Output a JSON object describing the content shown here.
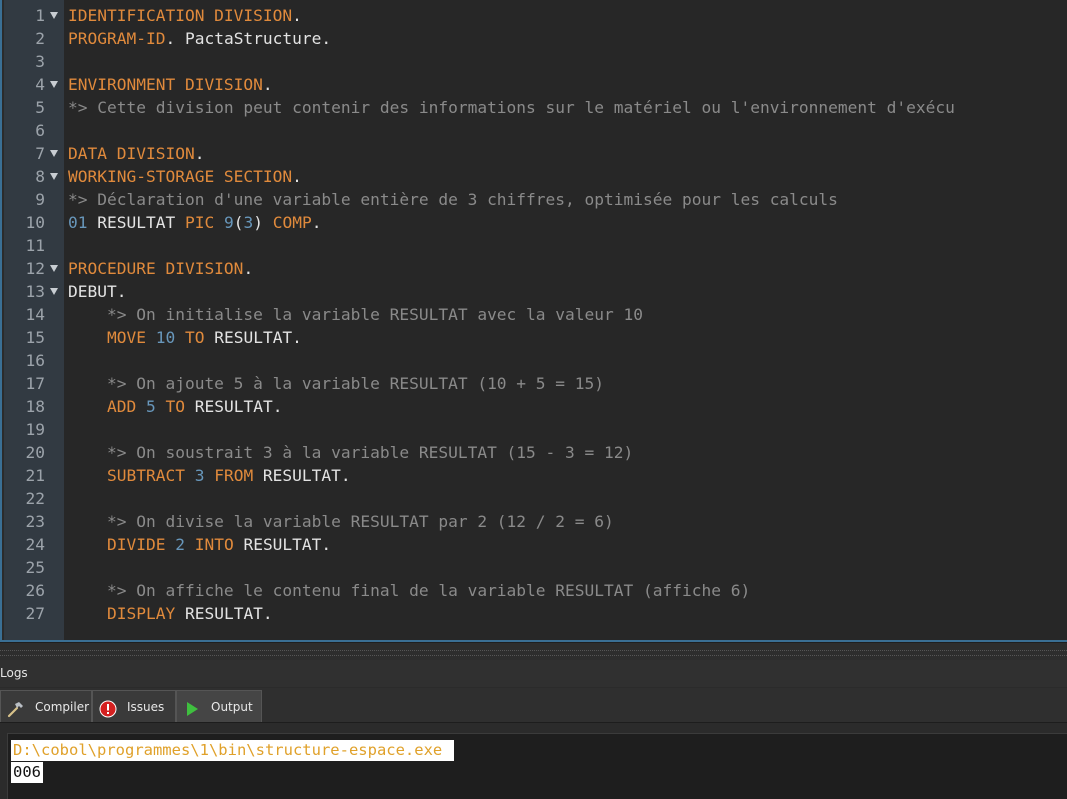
{
  "editor": {
    "lines": [
      {
        "n": "1",
        "fold": true,
        "segs": [
          {
            "t": "IDENTIFICATION DIVISION",
            "c": "kw"
          },
          {
            "t": ".",
            "c": "plain"
          }
        ]
      },
      {
        "n": "2",
        "fold": false,
        "segs": [
          {
            "t": "PROGRAM-ID",
            "c": "kw"
          },
          {
            "t": ". PactaStructure.",
            "c": "plain"
          }
        ]
      },
      {
        "n": "3",
        "fold": false,
        "segs": []
      },
      {
        "n": "4",
        "fold": true,
        "segs": [
          {
            "t": "ENVIRONMENT DIVISION",
            "c": "kw"
          },
          {
            "t": ".",
            "c": "plain"
          }
        ]
      },
      {
        "n": "5",
        "fold": false,
        "segs": [
          {
            "t": "*> Cette division peut contenir des informations sur le matériel ou l'environnement d'exécu",
            "c": "cmt"
          }
        ]
      },
      {
        "n": "6",
        "fold": false,
        "segs": []
      },
      {
        "n": "7",
        "fold": true,
        "segs": [
          {
            "t": "DATA DIVISION",
            "c": "kw"
          },
          {
            "t": ".",
            "c": "plain"
          }
        ]
      },
      {
        "n": "8",
        "fold": true,
        "segs": [
          {
            "t": "WORKING-STORAGE SECTION",
            "c": "kw"
          },
          {
            "t": ".",
            "c": "plain"
          }
        ]
      },
      {
        "n": "9",
        "fold": false,
        "segs": [
          {
            "t": "*> Déclaration d'une variable entière de 3 chiffres, optimisée pour les calculs",
            "c": "cmt"
          }
        ]
      },
      {
        "n": "10",
        "fold": false,
        "segs": [
          {
            "t": "01",
            "c": "num"
          },
          {
            "t": " RESULTAT ",
            "c": "plain"
          },
          {
            "t": "PIC",
            "c": "kw"
          },
          {
            "t": " ",
            "c": "plain"
          },
          {
            "t": "9",
            "c": "num"
          },
          {
            "t": "(",
            "c": "plain"
          },
          {
            "t": "3",
            "c": "num"
          },
          {
            "t": ") ",
            "c": "plain"
          },
          {
            "t": "COMP",
            "c": "kw"
          },
          {
            "t": ".",
            "c": "plain"
          }
        ]
      },
      {
        "n": "11",
        "fold": false,
        "segs": []
      },
      {
        "n": "12",
        "fold": true,
        "segs": [
          {
            "t": "PROCEDURE DIVISION",
            "c": "kw"
          },
          {
            "t": ".",
            "c": "plain"
          }
        ]
      },
      {
        "n": "13",
        "fold": true,
        "segs": [
          {
            "t": "DEBUT.",
            "c": "plain"
          }
        ]
      },
      {
        "n": "14",
        "fold": false,
        "segs": [
          {
            "t": "    *> On initialise la variable RESULTAT avec la valeur 10",
            "c": "cmt"
          }
        ]
      },
      {
        "n": "15",
        "fold": false,
        "segs": [
          {
            "t": "    ",
            "c": "plain"
          },
          {
            "t": "MOVE",
            "c": "kw"
          },
          {
            "t": " ",
            "c": "plain"
          },
          {
            "t": "10",
            "c": "num"
          },
          {
            "t": " ",
            "c": "plain"
          },
          {
            "t": "TO",
            "c": "kw"
          },
          {
            "t": " RESULTAT.",
            "c": "plain"
          }
        ]
      },
      {
        "n": "16",
        "fold": false,
        "segs": []
      },
      {
        "n": "17",
        "fold": false,
        "segs": [
          {
            "t": "    *> On ajoute 5 à la variable RESULTAT (10 + 5 = 15)",
            "c": "cmt"
          }
        ]
      },
      {
        "n": "18",
        "fold": false,
        "segs": [
          {
            "t": "    ",
            "c": "plain"
          },
          {
            "t": "ADD",
            "c": "kw"
          },
          {
            "t": " ",
            "c": "plain"
          },
          {
            "t": "5",
            "c": "num"
          },
          {
            "t": " ",
            "c": "plain"
          },
          {
            "t": "TO",
            "c": "kw"
          },
          {
            "t": " RESULTAT.",
            "c": "plain"
          }
        ]
      },
      {
        "n": "19",
        "fold": false,
        "segs": []
      },
      {
        "n": "20",
        "fold": false,
        "segs": [
          {
            "t": "    *> On soustrait 3 à la variable RESULTAT (15 - 3 = 12)",
            "c": "cmt"
          }
        ]
      },
      {
        "n": "21",
        "fold": false,
        "segs": [
          {
            "t": "    ",
            "c": "plain"
          },
          {
            "t": "SUBTRACT",
            "c": "kw"
          },
          {
            "t": " ",
            "c": "plain"
          },
          {
            "t": "3",
            "c": "num"
          },
          {
            "t": " ",
            "c": "plain"
          },
          {
            "t": "FROM",
            "c": "kw"
          },
          {
            "t": " RESULTAT.",
            "c": "plain"
          }
        ]
      },
      {
        "n": "22",
        "fold": false,
        "segs": []
      },
      {
        "n": "23",
        "fold": false,
        "segs": [
          {
            "t": "    *> On divise la variable RESULTAT par 2 (12 / 2 = 6)",
            "c": "cmt"
          }
        ]
      },
      {
        "n": "24",
        "fold": false,
        "segs": [
          {
            "t": "    ",
            "c": "plain"
          },
          {
            "t": "DIVIDE",
            "c": "kw"
          },
          {
            "t": " ",
            "c": "plain"
          },
          {
            "t": "2",
            "c": "num"
          },
          {
            "t": " ",
            "c": "plain"
          },
          {
            "t": "INTO",
            "c": "kw"
          },
          {
            "t": " RESULTAT.",
            "c": "plain"
          }
        ]
      },
      {
        "n": "25",
        "fold": false,
        "segs": []
      },
      {
        "n": "26",
        "fold": false,
        "segs": [
          {
            "t": "    *> On affiche le contenu final de la variable RESULTAT (affiche 6)",
            "c": "cmt"
          }
        ]
      },
      {
        "n": "27",
        "fold": false,
        "segs": [
          {
            "t": "    ",
            "c": "plain"
          },
          {
            "t": "DISPLAY",
            "c": "kw"
          },
          {
            "t": " RESULTAT.",
            "c": "plain"
          }
        ]
      }
    ]
  },
  "logs": {
    "title": "Logs",
    "tabs": {
      "compiler": {
        "label": "Compiler",
        "icon": "hammer-icon"
      },
      "issues": {
        "label": "Issues",
        "icon": "error-icon"
      },
      "output": {
        "label": "Output",
        "icon": "play-icon"
      }
    },
    "output": {
      "path": "D:\\cobol\\programmes\\1\\bin\\structure-espace.exe ",
      "result": "006"
    }
  },
  "colors": {
    "keyword": "#e08a3c",
    "number": "#6897bb",
    "comment": "#8a8a8a",
    "text": "#e3e3e3",
    "background": "#272727"
  }
}
